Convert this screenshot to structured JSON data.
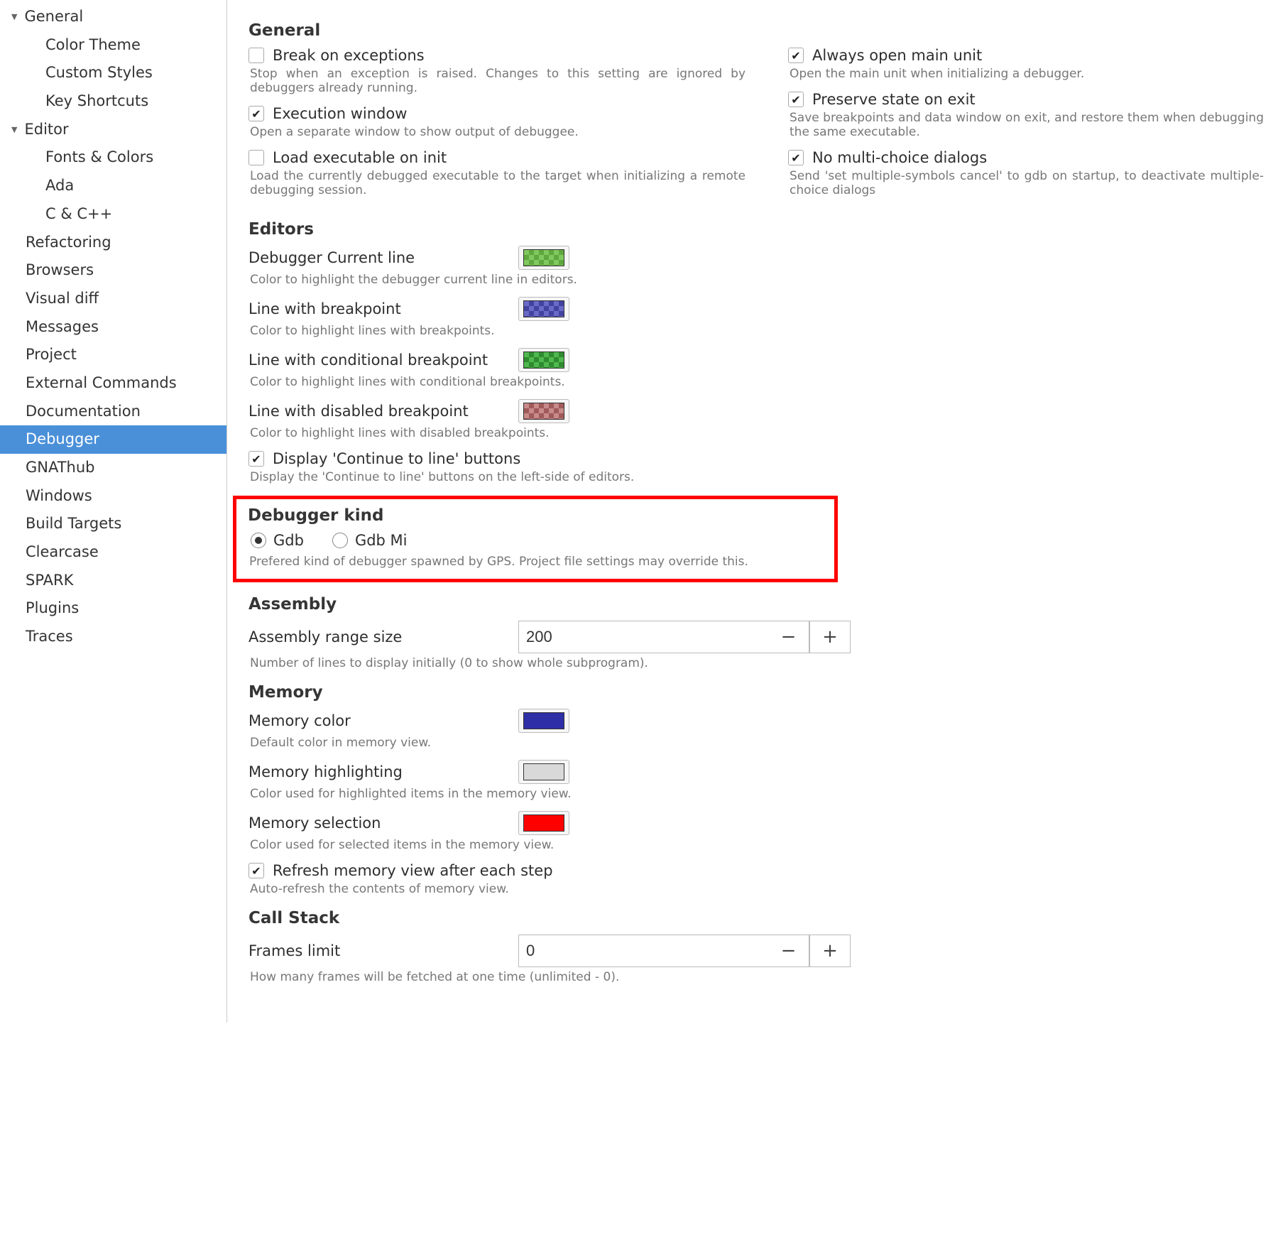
{
  "sidebar": {
    "items": [
      {
        "label": "General",
        "level": "top"
      },
      {
        "label": "Color Theme",
        "level": "sub"
      },
      {
        "label": "Custom Styles",
        "level": "sub"
      },
      {
        "label": "Key Shortcuts",
        "level": "sub"
      },
      {
        "label": "Editor",
        "level": "top"
      },
      {
        "label": "Fonts & Colors",
        "level": "sub"
      },
      {
        "label": "Ada",
        "level": "sub"
      },
      {
        "label": "C & C++",
        "level": "sub"
      },
      {
        "label": "Refactoring",
        "level": "plain"
      },
      {
        "label": "Browsers",
        "level": "plain"
      },
      {
        "label": "Visual diff",
        "level": "plain"
      },
      {
        "label": "Messages",
        "level": "plain"
      },
      {
        "label": "Project",
        "level": "plain"
      },
      {
        "label": "External Commands",
        "level": "plain"
      },
      {
        "label": "Documentation",
        "level": "plain"
      },
      {
        "label": "Debugger",
        "level": "plain",
        "selected": true
      },
      {
        "label": "GNAThub",
        "level": "plain"
      },
      {
        "label": "Windows",
        "level": "plain"
      },
      {
        "label": "Build Targets",
        "level": "plain"
      },
      {
        "label": "Clearcase",
        "level": "plain"
      },
      {
        "label": "SPARK",
        "level": "plain"
      },
      {
        "label": "Plugins",
        "level": "plain"
      },
      {
        "label": "Traces",
        "level": "plain"
      }
    ]
  },
  "sections": {
    "general_heading": "General",
    "editors_heading": "Editors",
    "debugger_kind_heading": "Debugger kind",
    "assembly_heading": "Assembly",
    "memory_heading": "Memory",
    "callstack_heading": "Call Stack"
  },
  "general": {
    "break_exceptions": {
      "label": "Break on exceptions",
      "desc": "Stop when an exception is raised. Changes to this setting are ignored by debuggers already running.",
      "checked": false
    },
    "exec_window": {
      "label": "Execution window",
      "desc": "Open a separate window to show output of debuggee.",
      "checked": true
    },
    "load_exec": {
      "label": "Load executable on init",
      "desc": "Load the currently debugged executable to the target when initializing a remote debugging session.",
      "checked": false
    },
    "open_main": {
      "label": "Always open main unit",
      "desc": "Open the main unit when initializing a debugger.",
      "checked": true
    },
    "preserve_state": {
      "label": "Preserve state on exit",
      "desc": "Save breakpoints and data window on exit, and restore them when debugging the same executable.",
      "checked": true
    },
    "no_multichoice": {
      "label": "No multi-choice dialogs",
      "desc": "Send 'set multiple-symbols cancel' to gdb on startup, to deactivate multiple-choice dialogs",
      "checked": true
    }
  },
  "editors": {
    "current_line": {
      "label": "Debugger Current line",
      "desc": "Color to highlight the debugger current line in editors.",
      "color1": "#5fa83f",
      "color2": "#7fc95f"
    },
    "bp_line": {
      "label": "Line with breakpoint",
      "desc": "Color to highlight lines with breakpoints.",
      "color1": "#4242a0",
      "color2": "#6a6ac8"
    },
    "cond_bp": {
      "label": "Line with conditional breakpoint",
      "desc": "Color to highlight lines with conditional breakpoints.",
      "color1": "#2f8b2f",
      "color2": "#4fb84f"
    },
    "disabled_bp": {
      "label": "Line with disabled breakpoint",
      "desc": "Color to highlight lines with disabled breakpoints.",
      "color1": "#a05a5a",
      "color2": "#c88a8a"
    },
    "continue_btns": {
      "label": "Display 'Continue to line' buttons",
      "desc": "Display the 'Continue to line' buttons on the left-side of editors.",
      "checked": true
    }
  },
  "debugger_kind": {
    "opt1": "Gdb",
    "opt2": "Gdb Mi",
    "selected": "Gdb",
    "desc": "Prefered kind of debugger spawned by GPS. Project file settings may override this."
  },
  "assembly": {
    "range": {
      "label": "Assembly range size",
      "value": "200",
      "desc": "Number of lines to display initially (0 to show whole subprogram)."
    }
  },
  "memory": {
    "mem_color": {
      "label": "Memory color",
      "desc": "Default color in memory view.",
      "color": "#2e2ea6"
    },
    "mem_hl": {
      "label": "Memory highlighting",
      "desc": "Color used for highlighted items in the memory view.",
      "color": "#d9d9d9"
    },
    "mem_sel": {
      "label": "Memory selection",
      "desc": "Color used for selected items in the memory view.",
      "color": "#ff0000"
    },
    "refresh": {
      "label": "Refresh memory view after each step",
      "desc": "Auto-refresh the contents of memory view.",
      "checked": true
    }
  },
  "callstack": {
    "frames": {
      "label": "Frames limit",
      "value": "0",
      "desc": "How many frames will be fetched at one time (unlimited - 0)."
    }
  }
}
